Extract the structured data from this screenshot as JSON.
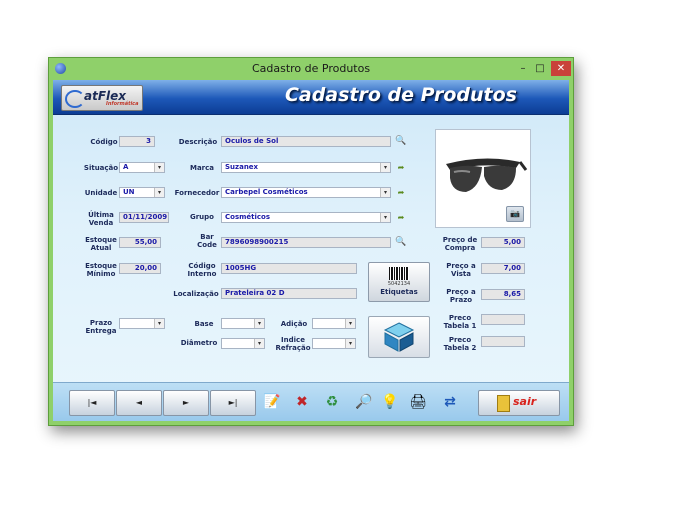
{
  "window": {
    "title": "Cadastro de Produtos",
    "min": "–",
    "max": "□",
    "close": "✕"
  },
  "banner": {
    "logo_text": "atFlex",
    "logo_sub": "Informática",
    "title": "Cadastro de Produtos"
  },
  "labels": {
    "codigo": "Código",
    "situacao": "Situação",
    "unidade": "Unidade",
    "ultima_venda_1": "Última",
    "ultima_venda_2": "Venda",
    "estoque_atual_1": "Estoque",
    "estoque_atual_2": "Atual",
    "estoque_minimo_1": "Estoque",
    "estoque_minimo_2": "Mínimo",
    "prazo_entrega_1": "Prazo",
    "prazo_entrega_2": "Entrega",
    "descricao": "Descrição",
    "marca": "Marca",
    "fornecedor": "Fornecedor",
    "grupo": "Grupo",
    "bar_code_1": "Bar",
    "bar_code_2": "Code",
    "codigo_interno_1": "Código",
    "codigo_interno_2": "Interno",
    "localizacao": "Localização",
    "base": "Base",
    "diametro": "Diâmetro",
    "adicao": "Adição",
    "indice_refracao_1": "Indice",
    "indice_refracao_2": "Refração",
    "preco_compra_1": "Preço de",
    "preco_compra_2": "Compra",
    "preco_vista_1": "Preço a",
    "preco_vista_2": "Vista",
    "preco_prazo_1": "Preço a",
    "preco_prazo_2": "Prazo",
    "preco_tabela1_1": "Preco",
    "preco_tabela1_2": "Tabela 1",
    "preco_tabela2_1": "Preco",
    "preco_tabela2_2": "Tabela 2"
  },
  "values": {
    "codigo": "3",
    "situacao": "A",
    "unidade": "UN",
    "ultima_venda": "01/11/2009",
    "estoque_atual": "55,00",
    "estoque_minimo": "20,00",
    "prazo_entrega": "",
    "descricao": "Óculos de Sol",
    "marca": "Suzanex",
    "fornecedor": "Carbepel Cosméticos",
    "grupo": "Cosméticos",
    "bar_code": "7896098900215",
    "codigo_interno": "1005HG",
    "localizacao": "Prateleira 02 D",
    "base": "",
    "diametro": "",
    "adicao": "",
    "indice_refracao": "",
    "preco_compra": "5,00",
    "preco_vista": "7,00",
    "preco_prazo": "8,65",
    "preco_tabela1": "",
    "preco_tabela2": ""
  },
  "etiquetas": {
    "barcode_number": "5042134",
    "label": "Etiquetas"
  },
  "toolbar": {
    "first": "|◄",
    "prev": "◄",
    "next": "►",
    "last": "►|",
    "sair": "sair"
  },
  "icons": {
    "search": "🔍",
    "go": "➦",
    "camera": "📷",
    "edit": "📝",
    "delete": "✖",
    "refresh": "♻",
    "find": "🔎",
    "tip": "💡",
    "print": "🖨",
    "transfer": "⇄"
  },
  "colors": {
    "accent": "#1d58b8",
    "value_text": "#1a1aa8",
    "sair": "#d8221c"
  }
}
